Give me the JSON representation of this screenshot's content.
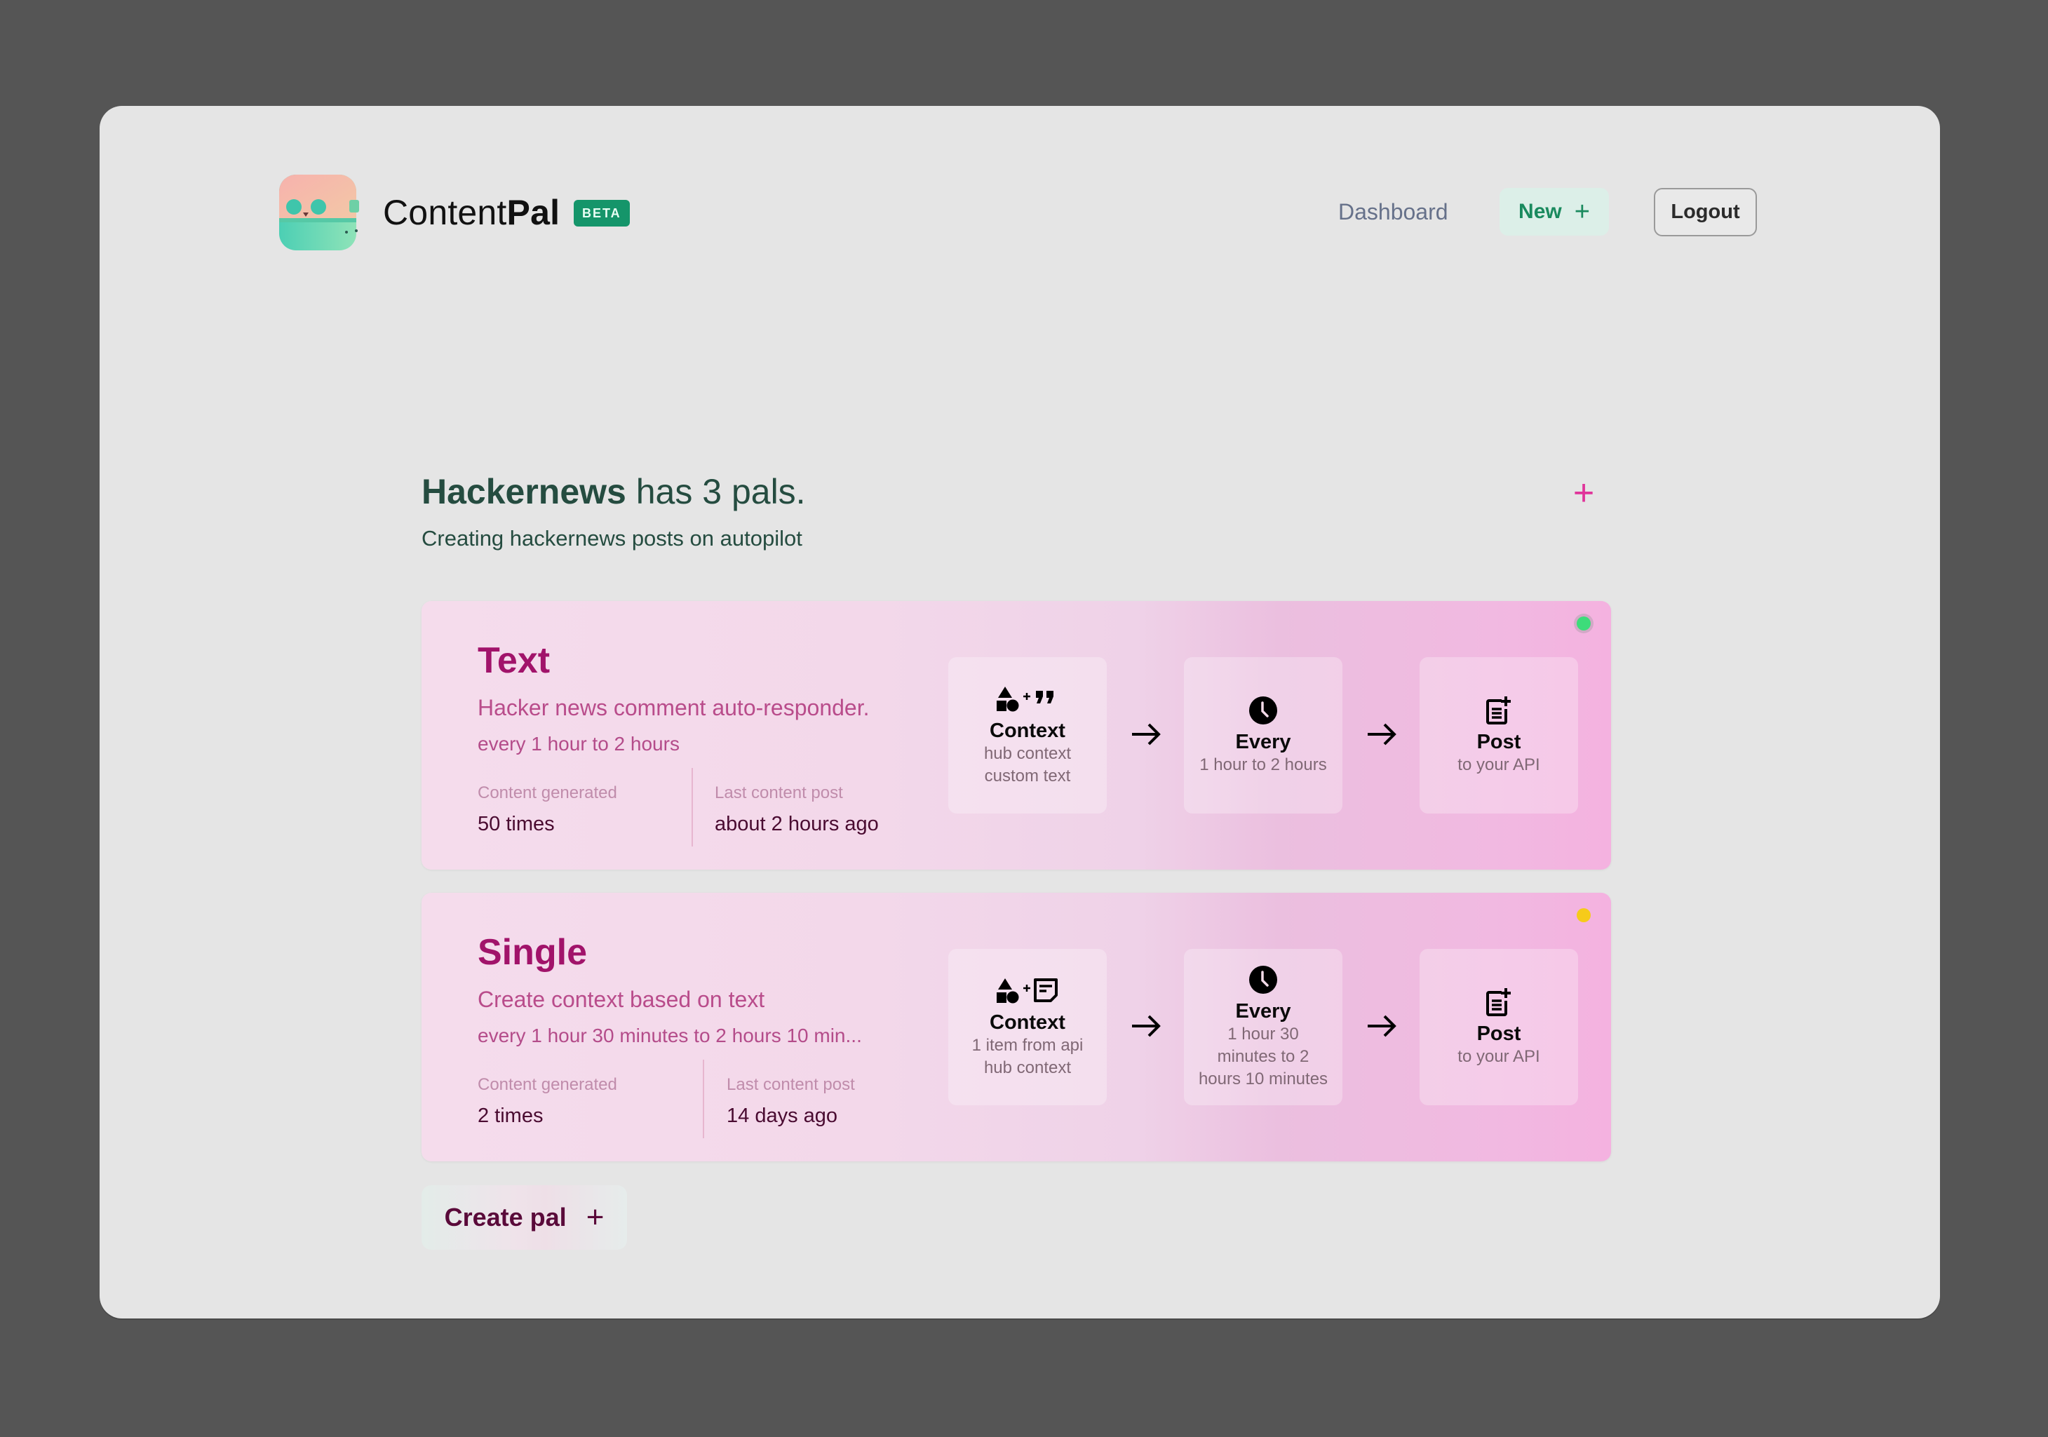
{
  "header": {
    "brand_light": "Content",
    "brand_bold": "Pal",
    "badge": "BETA",
    "nav": {
      "dashboard": "Dashboard",
      "new_label": "New",
      "new_icon": "+",
      "logout": "Logout"
    }
  },
  "hub": {
    "name": "Hackernews",
    "count_text": " has 3 pals.",
    "description": "Creating hackernews posts on autopilot",
    "add_icon": "+"
  },
  "colors": {
    "brand_green": "#15956a",
    "pal_title": "#a1136a",
    "status_active": "#3ddc7a",
    "status_pending": "#f6cb1a",
    "add_icon": "#e0349a"
  },
  "pals": [
    {
      "title": "Text",
      "description": "Hacker news comment auto-responder.",
      "schedule": "every 1 hour to 2 hours",
      "status": "active",
      "stats": [
        {
          "label": "Content generated",
          "value": "50 times"
        },
        {
          "label": "Last content post",
          "value": "about 2 hours ago"
        }
      ],
      "steps": [
        {
          "icon": "shapes-plus-quote-icon",
          "title": "Context",
          "lines": [
            "hub context",
            "custom text"
          ]
        },
        {
          "icon": "clock-icon",
          "title": "Every",
          "lines": [
            "1 hour to 2 hours"
          ]
        },
        {
          "icon": "post-add-icon",
          "title": "Post",
          "lines": [
            "to your API"
          ]
        }
      ]
    },
    {
      "title": "Single",
      "description": "Create context based on text",
      "schedule": "every 1 hour 30 minutes to 2 hours 10 min...",
      "status": "pending",
      "stats": [
        {
          "label": "Content generated",
          "value": "2 times"
        },
        {
          "label": "Last content post",
          "value": "14 days ago"
        }
      ],
      "steps": [
        {
          "icon": "shapes-plus-note-icon",
          "title": "Context",
          "lines": [
            "1 item from api",
            "hub context"
          ]
        },
        {
          "icon": "clock-icon",
          "title": "Every",
          "lines": [
            "1 hour 30",
            "minutes to 2",
            "hours 10 minutes"
          ]
        },
        {
          "icon": "post-add-icon",
          "title": "Post",
          "lines": [
            "to your API"
          ]
        }
      ]
    }
  ],
  "create_button": {
    "label": "Create pal",
    "icon": "+"
  }
}
